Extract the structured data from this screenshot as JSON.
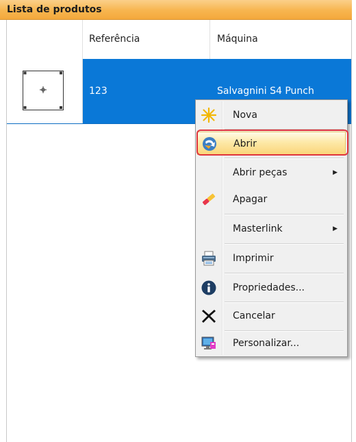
{
  "panel": {
    "title": "Lista de produtos"
  },
  "grid": {
    "columns": [
      "",
      "Referência",
      "Máquina"
    ],
    "rows": [
      {
        "referencia": "123",
        "maquina": "Salvagnini S4 Punch"
      }
    ]
  },
  "context_menu": {
    "items": [
      {
        "label": "Nova",
        "icon": "star-burst-icon"
      },
      {
        "label": "Abrir",
        "icon": "open-arrow-icon",
        "highlighted": true
      },
      {
        "label": "Abrir peças",
        "submenu": true,
        "arrow": "▶"
      },
      {
        "label": "Apagar",
        "icon": "eraser-icon"
      },
      {
        "label": "Masterlink",
        "submenu": true,
        "arrow": "▶"
      },
      {
        "label": "Imprimir",
        "icon": "printer-icon"
      },
      {
        "label": "Propriedades...",
        "icon": "info-icon"
      },
      {
        "label": "Cancelar",
        "icon": "cancel-x-icon"
      },
      {
        "label": "Personalizar...",
        "icon": "customize-monitor-icon"
      }
    ]
  },
  "colors": {
    "selection": "#0a78d7",
    "header_orange": "#f7b54f",
    "highlight_ring": "#e0343c"
  }
}
